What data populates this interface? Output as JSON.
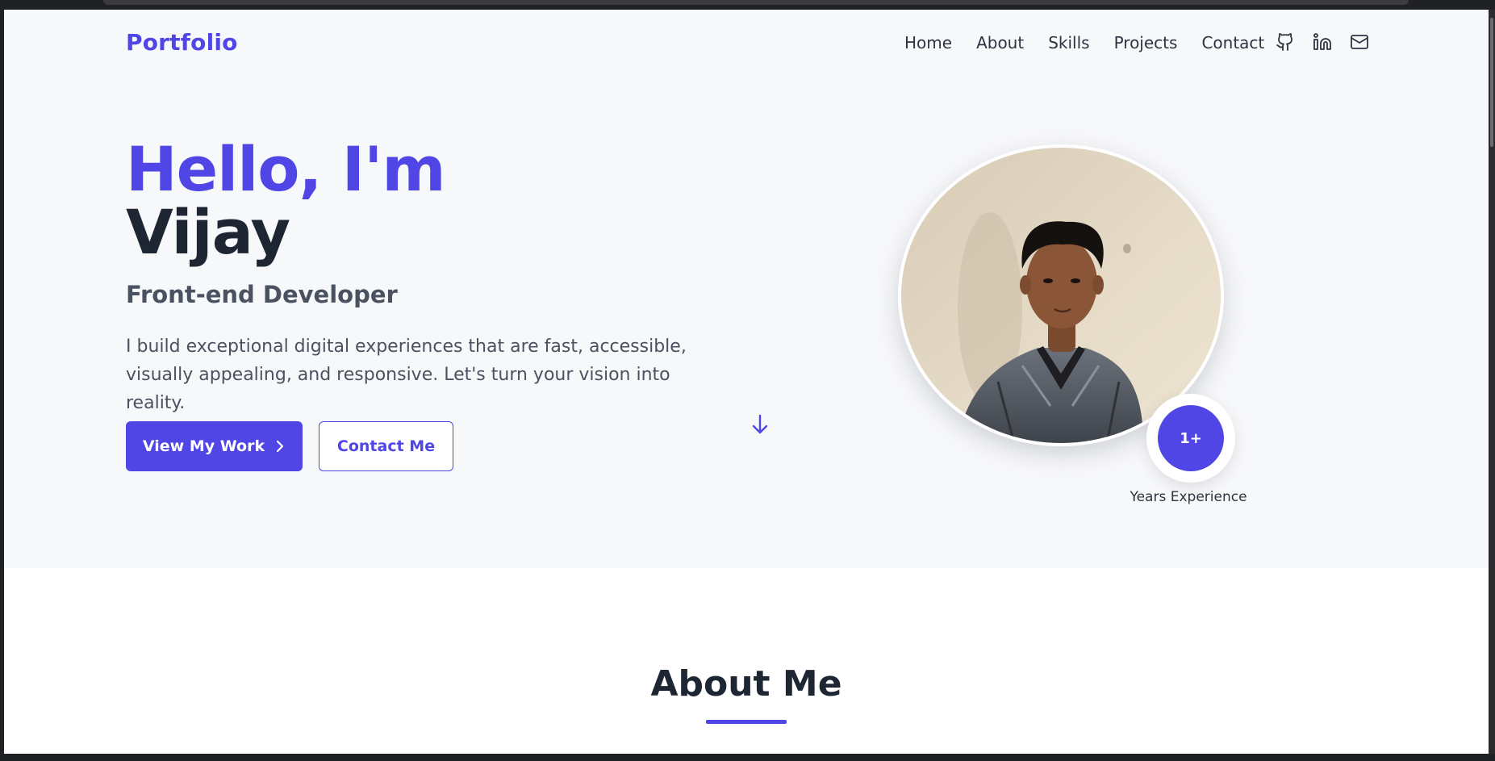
{
  "nav": {
    "logo": "Portfolio",
    "links": [
      "Home",
      "About",
      "Skills",
      "Projects",
      "Contact"
    ],
    "social_icons": [
      "github-icon",
      "linkedin-icon",
      "mail-icon"
    ]
  },
  "hero": {
    "greeting": "Hello, I'm",
    "name": "Vijay",
    "role": "Front-end Developer",
    "description": "I build exceptional digital experiences that are fast, accessible, visually appealing, and responsive. Let's turn your vision into reality.",
    "primary_button": "View My Work",
    "secondary_button": "Contact Me",
    "experience_value": "1+",
    "experience_label": "Years Experience"
  },
  "about": {
    "title": "About Me"
  },
  "colors": {
    "accent": "#4f46e5",
    "heading": "#1e2633",
    "body_text": "#4a5160",
    "hero_bg": "#f7f8fa"
  }
}
